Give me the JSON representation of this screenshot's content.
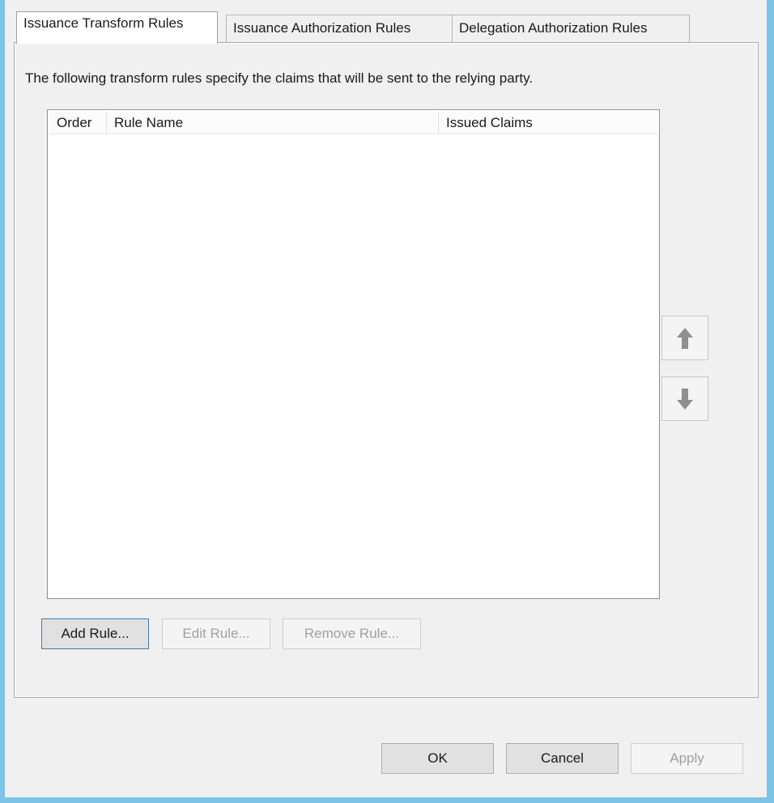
{
  "tabs": [
    {
      "label": "Issuance Transform Rules",
      "active": true
    },
    {
      "label": "Issuance Authorization Rules",
      "active": false
    },
    {
      "label": "Delegation Authorization Rules",
      "active": false
    }
  ],
  "panel": {
    "description": "The following transform rules specify the claims that will be sent to the relying party.",
    "rules_list": {
      "columns": [
        "Order",
        "Rule Name",
        "Issued Claims"
      ],
      "rows": []
    },
    "move_up": {
      "icon": "arrow-up-icon",
      "enabled": false
    },
    "move_down": {
      "icon": "arrow-down-icon",
      "enabled": false
    },
    "buttons": {
      "add_rule": "Add Rule...",
      "edit_rule": "Edit Rule...",
      "remove_rule": "Remove Rule..."
    }
  },
  "footer": {
    "ok": "OK",
    "cancel": "Cancel",
    "apply": "Apply"
  },
  "colors": {
    "window_border": "#7dc4e6",
    "default_button_border": "#3c7fb1",
    "disabled_text": "#a0a0a0"
  }
}
